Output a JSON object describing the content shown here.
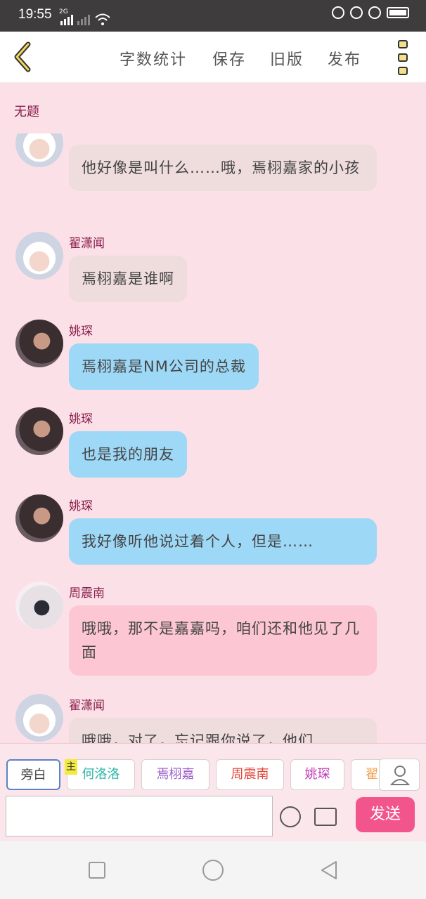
{
  "status_bar": {
    "time": "19:55",
    "signal": "2G"
  },
  "toolbar": {
    "word_count": "字数统计",
    "save": "保存",
    "old_version": "旧版",
    "publish": "发布"
  },
  "document": {
    "title": "无题"
  },
  "messages": [
    {
      "name": "",
      "text": "他好像是叫什么……哦，焉栩嘉家的小孩",
      "style": "grey"
    },
    {
      "name": "翟潇闻",
      "text": "焉栩嘉是谁啊",
      "style": "grey"
    },
    {
      "name": "姚琛",
      "text": "焉栩嘉是NM公司的总裁",
      "style": "blue"
    },
    {
      "name": "姚琛",
      "text": "也是我的朋友",
      "style": "blue"
    },
    {
      "name": "姚琛",
      "text": "我好像听他说过着个人，但是……",
      "style": "blue"
    },
    {
      "name": "周震南",
      "text": "哦哦，那不是嘉嘉吗，咱们还和他见了几面",
      "style": "pink"
    },
    {
      "name": "翟潇闻",
      "text": "哦哦，对了，忘记跟你说了，他们",
      "style": "grey"
    }
  ],
  "roles": [
    {
      "label": "旁白",
      "color": "#444444"
    },
    {
      "label": "何洛洛",
      "color": "#2fb6a8"
    },
    {
      "label": "焉栩嘉",
      "color": "#9a5cc8"
    },
    {
      "label": "周震南",
      "color": "#e0463a"
    },
    {
      "label": "姚琛",
      "color": "#c23bb8"
    },
    {
      "label": "翟",
      "color": "#f0a050"
    }
  ],
  "role_badge": "主",
  "composer": {
    "send": "发送",
    "placeholder": ""
  }
}
